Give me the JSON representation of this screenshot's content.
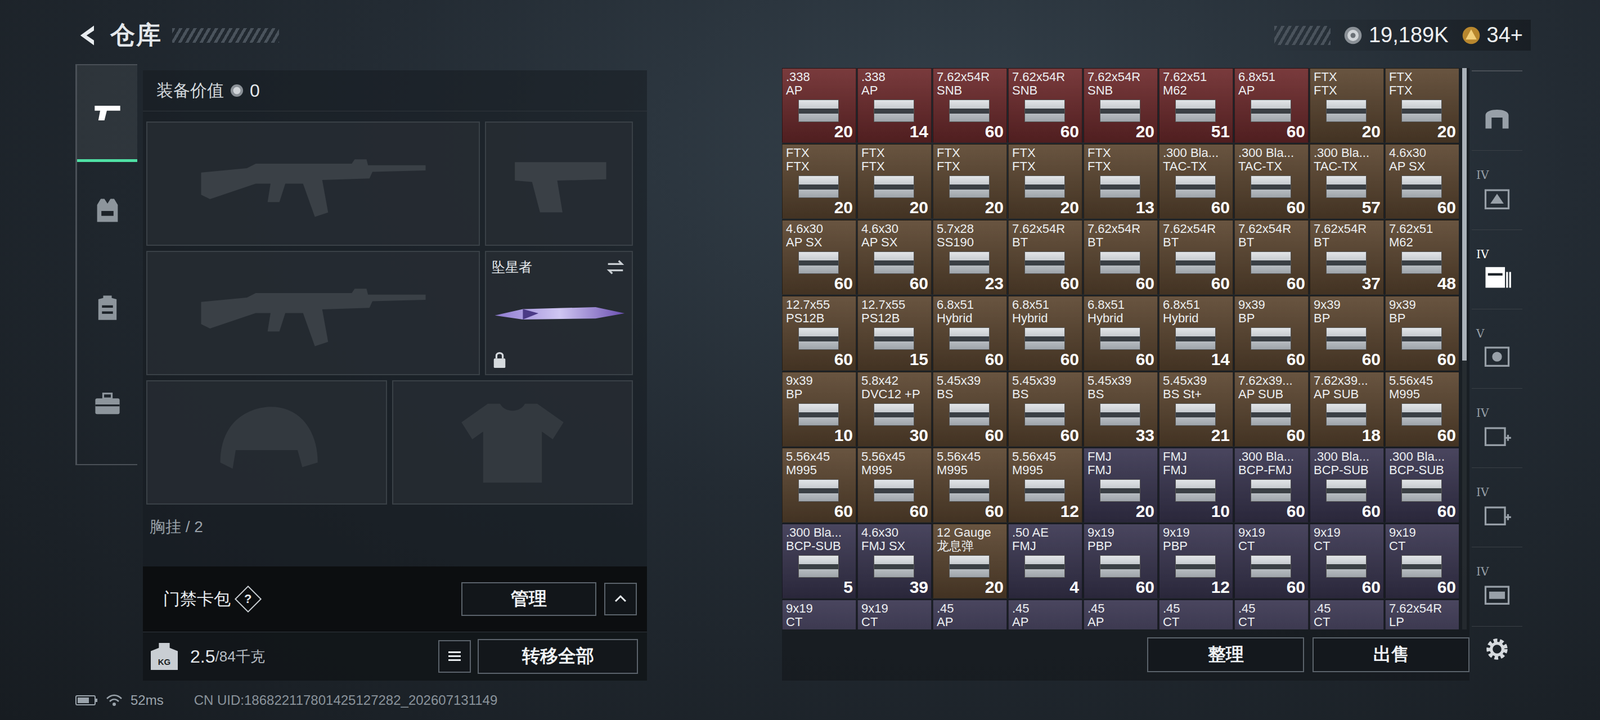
{
  "header": {
    "title": "仓库"
  },
  "currency": [
    {
      "kind": "coin",
      "amount": "19,189K"
    },
    {
      "kind": "bond",
      "amount": "34+"
    }
  ],
  "left_tabs": [
    {
      "kind": "weapons",
      "selected": true
    },
    {
      "kind": "vest",
      "selected": false
    },
    {
      "kind": "backpack",
      "selected": false
    },
    {
      "kind": "case",
      "selected": false
    }
  ],
  "equipment": {
    "value_label": "装备价值",
    "value": "0",
    "slots": [
      {
        "kind": "rifle",
        "name": "",
        "locked": false
      },
      {
        "kind": "pistol",
        "name": "",
        "locked": false
      },
      {
        "kind": "rifle",
        "name": "",
        "locked": false
      },
      {
        "kind": "melee",
        "name": "坠星者",
        "locked": true
      },
      {
        "kind": "helmet",
        "name": "",
        "locked": false
      },
      {
        "kind": "armor",
        "name": "",
        "locked": false
      }
    ],
    "chest_rig": "胸挂 / 2"
  },
  "card_pack": {
    "label": "门禁卡包",
    "help": "?",
    "button": "管理"
  },
  "weight": {
    "icon_label": "KG",
    "current": "2.5",
    "capacity": "/84千克"
  },
  "transfer_button": "转移全部",
  "stash": {
    "items": [
      {
        "caliber": ".338",
        "type": "AP",
        "count": "20",
        "color": "#6e2a2c"
      },
      {
        "caliber": ".338",
        "type": "AP",
        "count": "14",
        "color": "#6e2a2c"
      },
      {
        "caliber": "7.62x54R",
        "type": "SNB",
        "count": "60",
        "color": "#6e2a2c"
      },
      {
        "caliber": "7.62x54R",
        "type": "SNB",
        "count": "60",
        "color": "#6e2a2c"
      },
      {
        "caliber": "7.62x54R",
        "type": "SNB",
        "count": "20",
        "color": "#6e2a2c"
      },
      {
        "caliber": "7.62x51",
        "type": "M62",
        "count": "51",
        "color": "#6e2a2c"
      },
      {
        "caliber": "6.8x51",
        "type": "AP",
        "count": "60",
        "color": "#6e2a2c"
      },
      {
        "caliber": "FTX",
        "type": "FTX",
        "count": "20",
        "color": "#5c4630"
      },
      {
        "caliber": "FTX",
        "type": "FTX",
        "count": "20",
        "color": "#5c4630"
      },
      {
        "caliber": "FTX",
        "type": "FTX",
        "count": "20",
        "color": "#5c4630"
      },
      {
        "caliber": "FTX",
        "type": "FTX",
        "count": "20",
        "color": "#5c4630"
      },
      {
        "caliber": "FTX",
        "type": "FTX",
        "count": "20",
        "color": "#5c4630"
      },
      {
        "caliber": "FTX",
        "type": "FTX",
        "count": "20",
        "color": "#5c4630"
      },
      {
        "caliber": "FTX",
        "type": "FTX",
        "count": "13",
        "color": "#5c4630"
      },
      {
        "caliber": ".300 Bla...",
        "type": "TAC-TX",
        "count": "60",
        "color": "#5c4630"
      },
      {
        "caliber": ".300 Bla...",
        "type": "TAC-TX",
        "count": "60",
        "color": "#5c4630"
      },
      {
        "caliber": ".300 Bla...",
        "type": "TAC-TX",
        "count": "57",
        "color": "#5c4630"
      },
      {
        "caliber": "4.6x30",
        "type": "AP SX",
        "count": "60",
        "color": "#5c4630"
      },
      {
        "caliber": "4.6x30",
        "type": "AP SX",
        "count": "60",
        "color": "#5c4630"
      },
      {
        "caliber": "4.6x30",
        "type": "AP SX",
        "count": "60",
        "color": "#5c4630"
      },
      {
        "caliber": "5.7x28",
        "type": "SS190",
        "count": "23",
        "color": "#5c4630"
      },
      {
        "caliber": "7.62x54R",
        "type": "BT",
        "count": "60",
        "color": "#5c4630"
      },
      {
        "caliber": "7.62x54R",
        "type": "BT",
        "count": "60",
        "color": "#5c4630"
      },
      {
        "caliber": "7.62x54R",
        "type": "BT",
        "count": "60",
        "color": "#5c4630"
      },
      {
        "caliber": "7.62x54R",
        "type": "BT",
        "count": "60",
        "color": "#5c4630"
      },
      {
        "caliber": "7.62x54R",
        "type": "BT",
        "count": "37",
        "color": "#5c4630"
      },
      {
        "caliber": "7.62x51",
        "type": "M62",
        "count": "48",
        "color": "#5c4630"
      },
      {
        "caliber": "12.7x55",
        "type": "PS12B",
        "count": "60",
        "color": "#5c4630"
      },
      {
        "caliber": "12.7x55",
        "type": "PS12B",
        "count": "15",
        "color": "#5c4630"
      },
      {
        "caliber": "6.8x51",
        "type": "Hybrid",
        "count": "60",
        "color": "#5c4630"
      },
      {
        "caliber": "6.8x51",
        "type": "Hybrid",
        "count": "60",
        "color": "#5c4630"
      },
      {
        "caliber": "6.8x51",
        "type": "Hybrid",
        "count": "60",
        "color": "#5c4630"
      },
      {
        "caliber": "6.8x51",
        "type": "Hybrid",
        "count": "14",
        "color": "#5c4630"
      },
      {
        "caliber": "9x39",
        "type": "BP",
        "count": "60",
        "color": "#5c4630"
      },
      {
        "caliber": "9x39",
        "type": "BP",
        "count": "60",
        "color": "#5c4630"
      },
      {
        "caliber": "9x39",
        "type": "BP",
        "count": "60",
        "color": "#5c4630"
      },
      {
        "caliber": "9x39",
        "type": "BP",
        "count": "10",
        "color": "#5c4630"
      },
      {
        "caliber": "5.8x42",
        "type": "DVC12 +P",
        "count": "30",
        "color": "#5c4630"
      },
      {
        "caliber": "5.45x39",
        "type": "BS",
        "count": "60",
        "color": "#5c4630"
      },
      {
        "caliber": "5.45x39",
        "type": "BS",
        "count": "60",
        "color": "#5c4630"
      },
      {
        "caliber": "5.45x39",
        "type": "BS",
        "count": "33",
        "color": "#5c4630"
      },
      {
        "caliber": "5.45x39",
        "type": "BS St+",
        "count": "21",
        "color": "#5c4630"
      },
      {
        "caliber": "7.62x39...",
        "type": "AP SUB",
        "count": "60",
        "color": "#5c4630"
      },
      {
        "caliber": "7.62x39...",
        "type": "AP SUB",
        "count": "18",
        "color": "#5c4630"
      },
      {
        "caliber": "5.56x45",
        "type": "M995",
        "count": "60",
        "color": "#5c4630"
      },
      {
        "caliber": "5.56x45",
        "type": "M995",
        "count": "60",
        "color": "#5c4630"
      },
      {
        "caliber": "5.56x45",
        "type": "M995",
        "count": "60",
        "color": "#5c4630"
      },
      {
        "caliber": "5.56x45",
        "type": "M995",
        "count": "60",
        "color": "#5c4630"
      },
      {
        "caliber": "5.56x45",
        "type": "M995",
        "count": "12",
        "color": "#5c4630"
      },
      {
        "caliber": "FMJ",
        "type": "FMJ",
        "count": "20",
        "color": "#3a3651"
      },
      {
        "caliber": "FMJ",
        "type": "FMJ",
        "count": "10",
        "color": "#3a3651"
      },
      {
        "caliber": ".300 Bla...",
        "type": "BCP-FMJ",
        "count": "60",
        "color": "#3a3651"
      },
      {
        "caliber": ".300 Bla...",
        "type": "BCP-SUB",
        "count": "60",
        "color": "#3a3651"
      },
      {
        "caliber": ".300 Bla...",
        "type": "BCP-SUB",
        "count": "60",
        "color": "#3a3651"
      },
      {
        "caliber": ".300 Bla...",
        "type": "BCP-SUB",
        "count": "5",
        "color": "#3a3651"
      },
      {
        "caliber": "4.6x30",
        "type": "FMJ SX",
        "count": "39",
        "color": "#3a3651"
      },
      {
        "caliber": "12 Gauge",
        "type": "龙息弹",
        "count": "20",
        "color": "#5c4630"
      },
      {
        "caliber": ".50 AE",
        "type": "FMJ",
        "count": "4",
        "color": "#3a3651"
      },
      {
        "caliber": "9x19",
        "type": "PBP",
        "count": "60",
        "color": "#3a3651"
      },
      {
        "caliber": "9x19",
        "type": "PBP",
        "count": "12",
        "color": "#3a3651"
      },
      {
        "caliber": "9x19",
        "type": "CT",
        "count": "60",
        "color": "#3a3651"
      },
      {
        "caliber": "9x19",
        "type": "CT",
        "count": "60",
        "color": "#3a3651"
      },
      {
        "caliber": "9x19",
        "type": "CT",
        "count": "60",
        "color": "#3a3651"
      },
      {
        "caliber": "9x19",
        "type": "CT",
        "count": "",
        "color": "#3a3651"
      },
      {
        "caliber": "9x19",
        "type": "CT",
        "count": "",
        "color": "#3a3651"
      },
      {
        "caliber": ".45",
        "type": "AP",
        "count": "",
        "color": "#3a3651"
      },
      {
        "caliber": ".45",
        "type": "AP",
        "count": "",
        "color": "#3a3651"
      },
      {
        "caliber": ".45",
        "type": "AP",
        "count": "",
        "color": "#3a3651"
      },
      {
        "caliber": ".45",
        "type": "CT",
        "count": "",
        "color": "#3a3651"
      },
      {
        "caliber": ".45",
        "type": "CT",
        "count": "",
        "color": "#3a3651"
      },
      {
        "caliber": ".45",
        "type": "CT",
        "count": "",
        "color": "#3a3651"
      },
      {
        "caliber": "7.62x54R",
        "type": "LP",
        "count": "",
        "color": "#3a3651"
      }
    ],
    "buttons": [
      "整理",
      "出售"
    ]
  },
  "stash_tabs": [
    {
      "kind": "home",
      "tier": "",
      "selected": false
    },
    {
      "kind": "weapon-box",
      "tier": "IV",
      "selected": false
    },
    {
      "kind": "ammo-box",
      "tier": "IV",
      "selected": true
    },
    {
      "kind": "gear-box",
      "tier": "V",
      "selected": false
    },
    {
      "kind": "medical",
      "tier": "IV",
      "selected": false
    },
    {
      "kind": "medical",
      "tier": "IV",
      "selected": false
    },
    {
      "kind": "misc",
      "tier": "IV",
      "selected": false
    }
  ],
  "status": {
    "ping": "52ms",
    "uid": "CN UID:186822117801425127282_202607131149"
  }
}
